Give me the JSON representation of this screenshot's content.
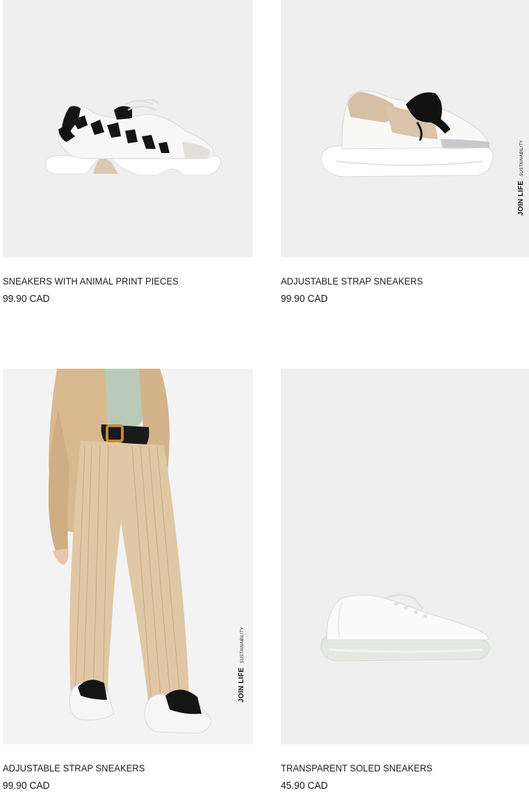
{
  "products": [
    {
      "name": "SNEAKERS WITH ANIMAL PRINT PIECES",
      "price": "99.90 CAD",
      "image": "white-sneaker-zebra-print-icon",
      "badge": null
    },
    {
      "name": "ADJUSTABLE STRAP SNEAKERS",
      "price": "99.90 CAD",
      "image": "white-sneaker-beige-strap-icon",
      "badge": {
        "main": "JOIN LIFE",
        "sub": "SUSTAINABILITY"
      }
    },
    {
      "name": "ADJUSTABLE STRAP SNEAKERS",
      "price": "99.90 CAD",
      "image": "model-beige-suit-sneakers-photo",
      "badge": {
        "main": "JOIN LIFE",
        "sub": "SUSTAINABILITY"
      }
    },
    {
      "name": "TRANSPARENT SOLED SNEAKERS",
      "price": "45.90 CAD",
      "image": "white-sneaker-clear-sole-icon",
      "badge": null
    }
  ],
  "colors": {
    "image_background": "#efefef",
    "text": "#1a1a1a"
  }
}
